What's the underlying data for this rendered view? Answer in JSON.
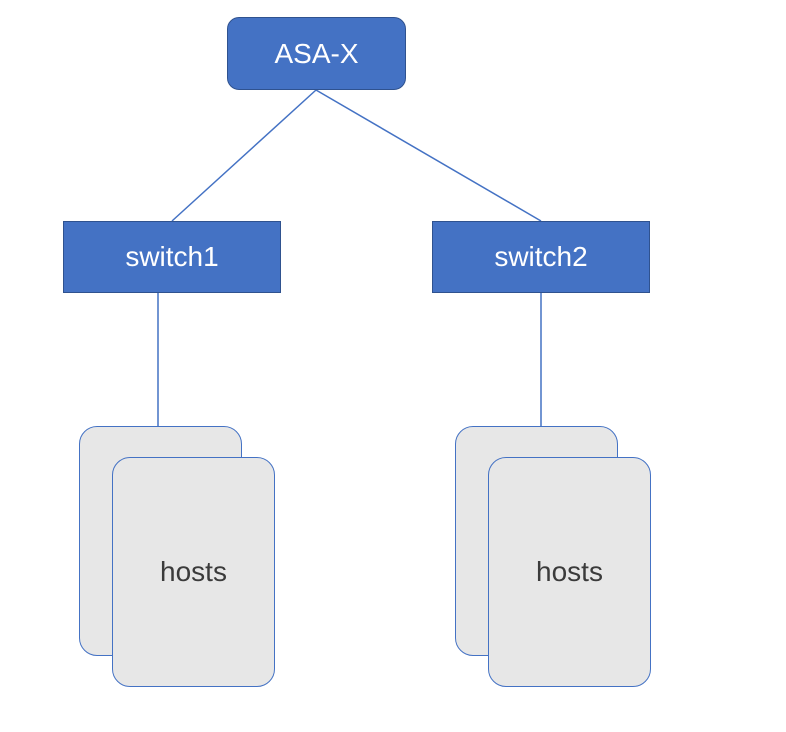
{
  "diagram": {
    "root": {
      "label": "ASA-X"
    },
    "switches": [
      {
        "label": "switch1"
      },
      {
        "label": "switch2"
      }
    ],
    "host_groups": [
      {
        "label": "hosts"
      },
      {
        "label": "hosts"
      }
    ]
  },
  "colors": {
    "node_fill": "#4472C4",
    "node_border": "#2F528F",
    "card_fill": "#E7E7E7",
    "connector": "#4472C4"
  }
}
